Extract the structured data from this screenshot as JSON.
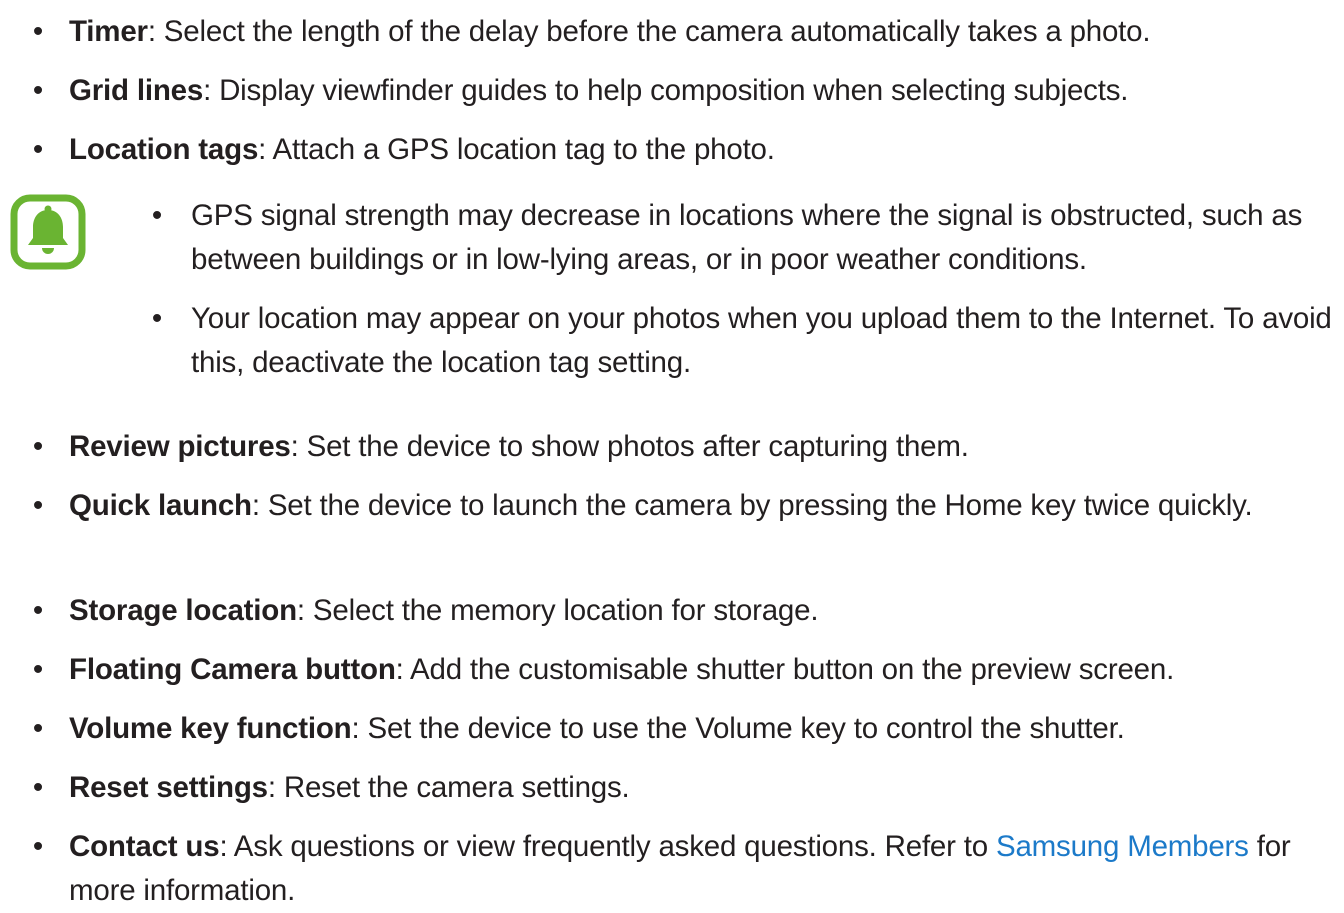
{
  "bullet_char": "•",
  "items_top": [
    {
      "term": "Timer",
      "desc": ": Select the length of the delay before the camera automatically takes a photo."
    },
    {
      "term": "Grid lines",
      "desc": ": Display viewfinder guides to help composition when selecting subjects."
    },
    {
      "term": "Location tags",
      "desc": ": Attach a GPS location tag to the photo."
    }
  ],
  "note": {
    "icon": "notification-bell-icon",
    "icon_color": "#6ab432",
    "items": [
      "GPS signal strength may decrease in locations where the signal is obstructed, such as between buildings or in low-lying areas, or in poor weather conditions.",
      "Your location may appear on your photos when you upload them to the Internet. To avoid this, deactivate the location tag setting."
    ]
  },
  "items_bottom": [
    {
      "term": "Review pictures",
      "desc": ": Set the device to show photos after capturing them."
    },
    {
      "term": "Quick launch",
      "desc": ": Set the device to launch the camera by pressing the Home key twice quickly."
    },
    {
      "term": "Storage location",
      "desc": ": Select the memory location for storage."
    },
    {
      "term": "Floating Camera button",
      "desc": ": Add the customisable shutter button on the preview screen."
    },
    {
      "term": "Volume key function",
      "desc": ": Set the device to use the Volume key to control the shutter."
    },
    {
      "term": "Reset settings",
      "desc": ": Reset the camera settings."
    }
  ],
  "contact": {
    "term": "Contact us",
    "desc_before": ": Ask questions or view frequently asked questions. Refer to ",
    "link_text": "Samsung Members",
    "desc_after": " for more information.",
    "link_color": "#1c7ac9"
  }
}
